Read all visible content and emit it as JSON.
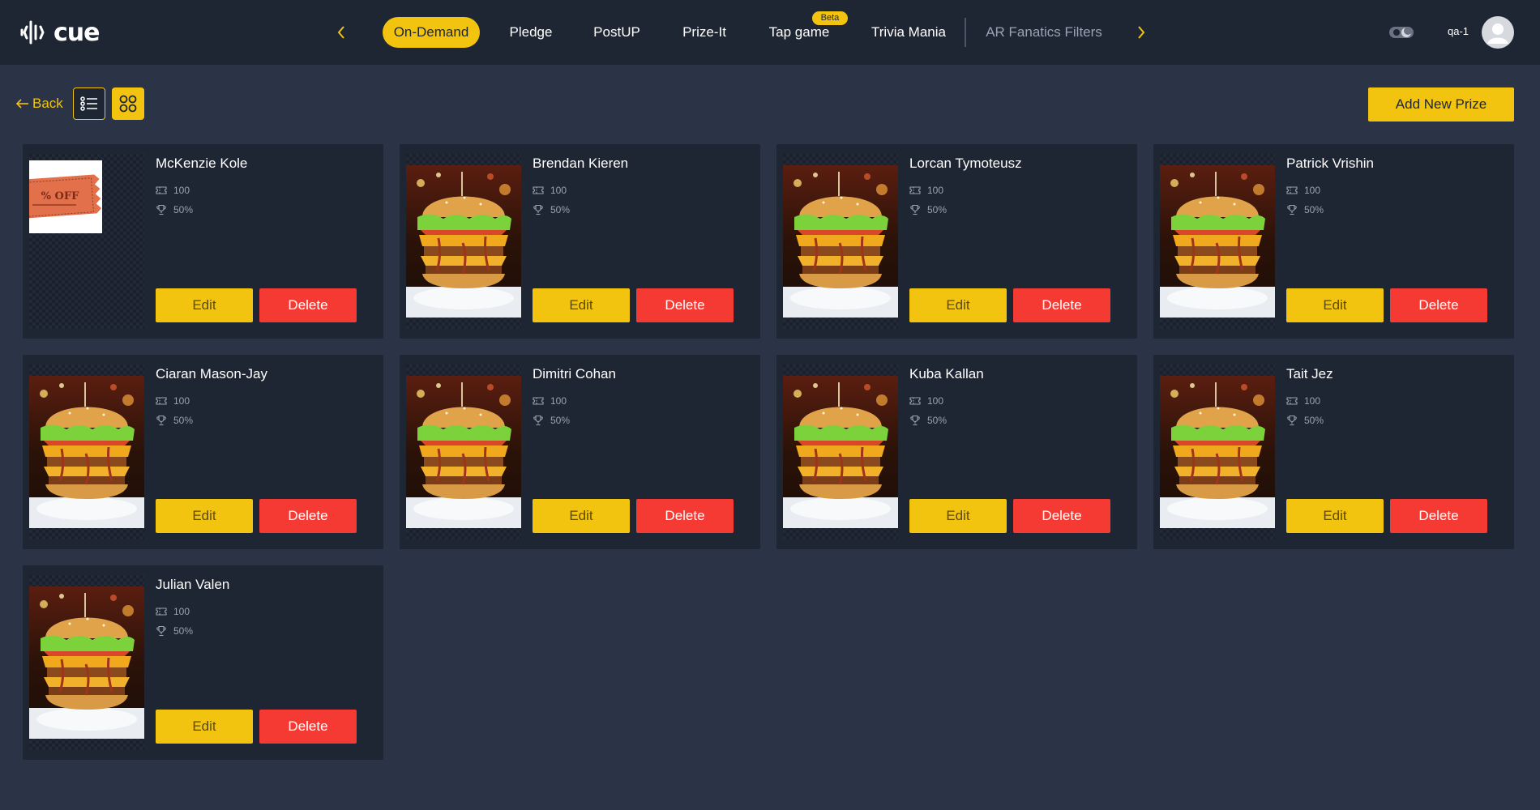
{
  "header": {
    "logo_text": "cue",
    "tabs": [
      {
        "label": "On-Demand",
        "active": true
      },
      {
        "label": "Pledge"
      },
      {
        "label": "PostUP"
      },
      {
        "label": "Prize-It"
      },
      {
        "label": "Tap game"
      },
      {
        "label": "Trivia Mania"
      },
      {
        "label": "AR Fanatics Filters"
      }
    ],
    "beta_badge": "Beta",
    "user_name": "qa-1"
  },
  "toolbar": {
    "back_label": "Back",
    "add_prize_label": "Add New Prize"
  },
  "prizes": [
    {
      "name": "McKenzie Kole",
      "points": "100",
      "percent": "50%",
      "image": "coupon",
      "edit_label": "Edit",
      "delete_label": "Delete"
    },
    {
      "name": "Brendan Kieren",
      "points": "100",
      "percent": "50%",
      "image": "burger",
      "edit_label": "Edit",
      "delete_label": "Delete"
    },
    {
      "name": "Lorcan Tymoteusz",
      "points": "100",
      "percent": "50%",
      "image": "burger",
      "edit_label": "Edit",
      "delete_label": "Delete"
    },
    {
      "name": "Patrick Vrishin",
      "points": "100",
      "percent": "50%",
      "image": "burger",
      "edit_label": "Edit",
      "delete_label": "Delete"
    },
    {
      "name": "Ciaran Mason-Jay",
      "points": "100",
      "percent": "50%",
      "image": "burger",
      "edit_label": "Edit",
      "delete_label": "Delete"
    },
    {
      "name": "Dimitri Cohan",
      "points": "100",
      "percent": "50%",
      "image": "burger",
      "edit_label": "Edit",
      "delete_label": "Delete"
    },
    {
      "name": "Kuba Kallan",
      "points": "100",
      "percent": "50%",
      "image": "burger",
      "edit_label": "Edit",
      "delete_label": "Delete"
    },
    {
      "name": "Tait Jez",
      "points": "100",
      "percent": "50%",
      "image": "burger",
      "edit_label": "Edit",
      "delete_label": "Delete"
    },
    {
      "name": "Julian Valen",
      "points": "100",
      "percent": "50%",
      "image": "burger",
      "edit_label": "Edit",
      "delete_label": "Delete"
    }
  ],
  "coupon_text": "% OFF",
  "colors": {
    "accent": "#f2c40f",
    "danger": "#f53a33",
    "background": "#2a3446",
    "panel": "#1e2533"
  }
}
